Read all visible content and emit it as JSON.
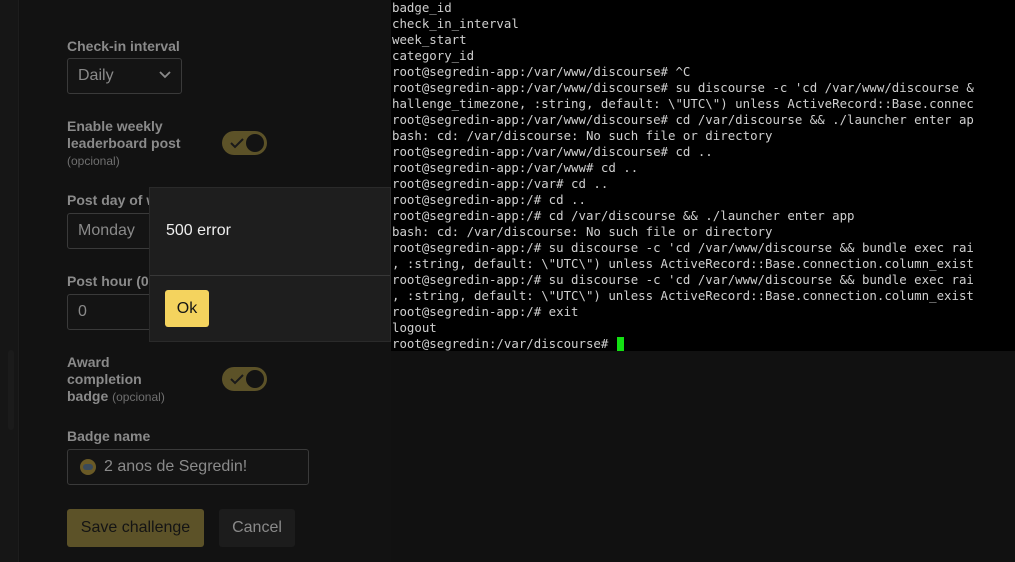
{
  "form": {
    "checkin_label": "Check-in interval",
    "checkin_value": "Daily",
    "weekly_label": "Enable weekly leaderboard post",
    "weekly_optional": "(opcional)",
    "post_day_label": "Post day of w",
    "post_day_value": "Monday",
    "post_hour_label": "Post hour (0",
    "post_hour_value": "0",
    "award_label": "Award completion badge",
    "award_optional": "(opcional)",
    "badge_name_label": "Badge name",
    "badge_name_value": "2 anos de Segredin!",
    "save_label": "Save challenge",
    "cancel_label": "Cancel"
  },
  "modal": {
    "message": "500 error",
    "ok_label": "Ok"
  },
  "terminal": {
    "lines": [
      "badge_id",
      "check_in_interval",
      "week_start",
      "category_id",
      "root@segredin-app:/var/www/discourse# ^C",
      "root@segredin-app:/var/www/discourse# su discourse -c 'cd /var/www/discourse &",
      "hallenge_timezone, :string, default: \\\"UTC\\\") unless ActiveRecord::Base.connec",
      "root@segredin-app:/var/www/discourse# cd /var/discourse && ./launcher enter ap",
      "bash: cd: /var/discourse: No such file or directory",
      "root@segredin-app:/var/www/discourse# cd ..",
      "root@segredin-app:/var/www# cd ..",
      "root@segredin-app:/var# cd ..",
      "root@segredin-app:/# cd ..",
      "root@segredin-app:/# cd /var/discourse && ./launcher enter app",
      "bash: cd: /var/discourse: No such file or directory",
      "root@segredin-app:/# su discourse -c 'cd /var/www/discourse && bundle exec rai",
      ", :string, default: \\\"UTC\\\") unless ActiveRecord::Base.connection.column_exist",
      "root@segredin-app:/# su discourse -c 'cd /var/www/discourse && bundle exec rai",
      ", :string, default: \\\"UTC\\\") unless ActiveRecord::Base.connection.column_exist",
      "root@segredin-app:/# exit",
      "logout",
      "root@segredin:/var/discourse#"
    ]
  },
  "colors": {
    "accent": "#f4d35e",
    "terminal_bg": "#000000",
    "cursor": "#13e013"
  }
}
